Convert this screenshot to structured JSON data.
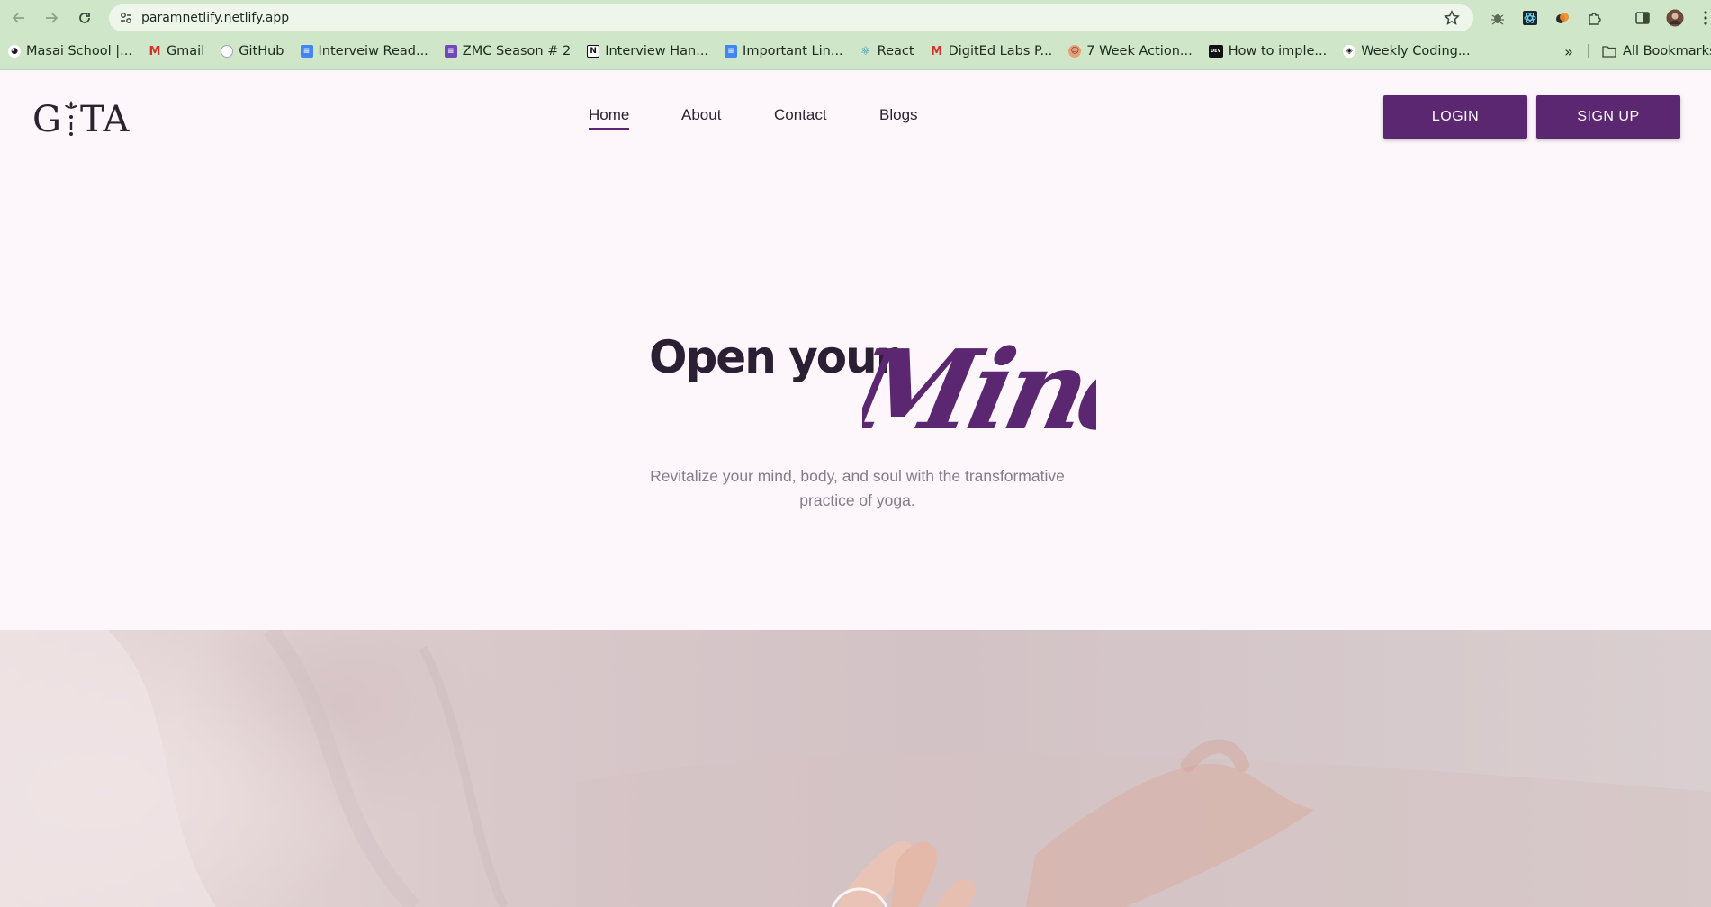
{
  "browser": {
    "url": "paramnetlify.netlify.app",
    "bookmarks": [
      {
        "label": "Masai School |...",
        "icon": "masai-icon"
      },
      {
        "label": "Gmail",
        "icon": "gmail-icon"
      },
      {
        "label": "GitHub",
        "icon": "github-icon"
      },
      {
        "label": "Interveiw Read...",
        "icon": "google-docs-icon"
      },
      {
        "label": "ZMC Season # 2",
        "icon": "google-forms-icon"
      },
      {
        "label": "Interview Han...",
        "icon": "notion-icon"
      },
      {
        "label": "Important Lin...",
        "icon": "google-docs-icon"
      },
      {
        "label": "React",
        "icon": "react-icon"
      },
      {
        "label": "DigitEd Labs P...",
        "icon": "gmail-icon"
      },
      {
        "label": "7 Week Action...",
        "icon": "avatar-icon"
      },
      {
        "label": "How to imple...",
        "icon": "dev-icon"
      },
      {
        "label": "Weekly Coding...",
        "icon": "codepen-icon"
      }
    ],
    "all_bookmarks_label": "All Bookmarks"
  },
  "site": {
    "logo_text_left": "G",
    "logo_text_right": "TA",
    "nav": [
      {
        "label": "Home",
        "active": true
      },
      {
        "label": "About",
        "active": false
      },
      {
        "label": "Contact",
        "active": false
      },
      {
        "label": "Blogs",
        "active": false
      }
    ],
    "login_label": "LOGIN",
    "signup_label": "SIGN UP",
    "accent": "#5b2770"
  },
  "hero": {
    "title": "Open your",
    "script_word": "Mind",
    "subtitle": "Revitalize your mind, body, and soul with the transformative practice of yoga."
  }
}
